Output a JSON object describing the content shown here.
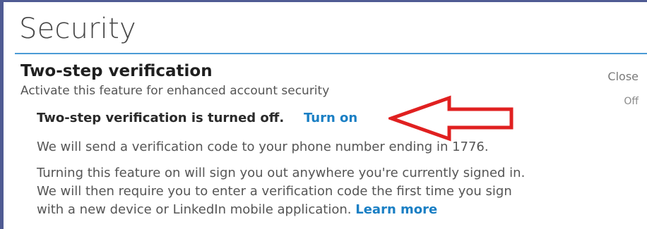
{
  "page": {
    "title": "Security"
  },
  "section": {
    "heading": "Two-step verification",
    "subtitle": "Activate this feature for enhanced account security",
    "close_label": "Close",
    "status_label": "Off"
  },
  "verification": {
    "status_text": "Two-step verification is turned off.",
    "turn_on_label": "Turn on",
    "phone_text": "We will send a verification code to your phone number ending in 1776.",
    "info_line_1": "Turning this feature on will sign you out anywhere you're currently signed in.",
    "info_line_2": "We will then require you to enter a verification code the first time you sign",
    "info_line_3": "with a new device or LinkedIn mobile application.",
    "learn_more_label": "Learn more"
  },
  "colors": {
    "frame_border": "#4f5b93",
    "accent_rule": "#4b9bd6",
    "link": "#1a7fc4",
    "annotation_arrow": "#e02020"
  },
  "icons": {
    "annotation": "red-arrow-left-icon"
  }
}
